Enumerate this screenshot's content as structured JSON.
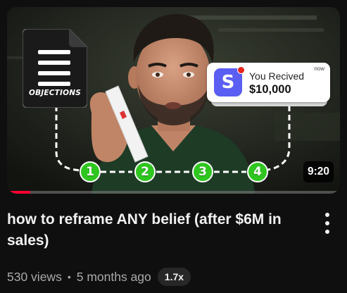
{
  "video": {
    "title": "how to reframe ANY belief (after $6M in sales)",
    "duration": "9:20",
    "views": "530 views",
    "separator": "•",
    "age": "5 months ago",
    "playback_speed": "1.7x",
    "watched_fraction": 0.07
  },
  "thumbnail": {
    "objections_label": "OBJECTIONS",
    "notification": {
      "app_letter": "S",
      "title": "You Recived",
      "amount": "$10,000",
      "time": "now"
    },
    "steps": [
      "1",
      "2",
      "3",
      "4"
    ]
  },
  "colors": {
    "progress": "#ff0033",
    "step_green": "#2ec61f",
    "app_icon": "#5b5ef2",
    "background": "#0f0f0f"
  },
  "icons": {
    "more": "vertical-ellipsis-icon",
    "objections": "document-list-icon",
    "app": "stripe-s-icon"
  }
}
